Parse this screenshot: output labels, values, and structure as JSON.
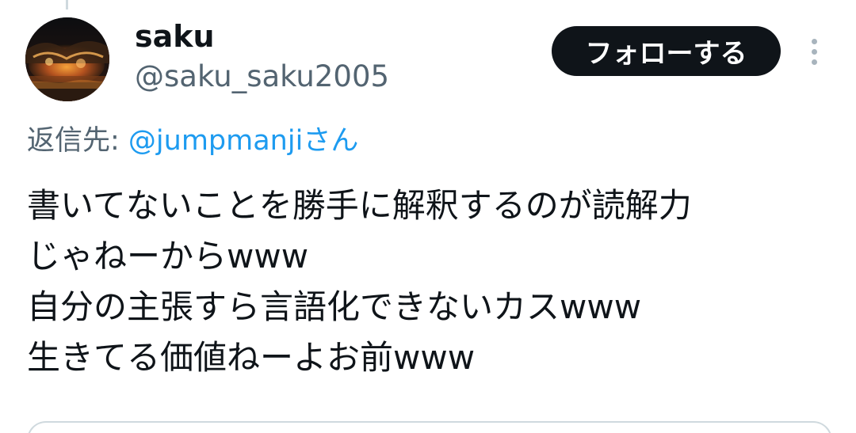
{
  "user": {
    "name": "saku",
    "handle": "@saku_saku2005"
  },
  "actions": {
    "follow_label": "フォローする"
  },
  "reply": {
    "prefix": "返信先: ",
    "target": "@jumpmanjiさん"
  },
  "tweet": {
    "lines": [
      "書いてないことを勝手に解釈するのが読解力",
      "じゃねーからwww",
      "自分の主張すら言語化できないカスwww",
      "生きてる価値ねーよお前www"
    ]
  },
  "icons": {
    "more": "more-vertical-icon"
  },
  "colors": {
    "text": "#0f1419",
    "secondary": "#536471",
    "link": "#1d9bf0",
    "button": "#0f1419",
    "border": "#cfd9de"
  }
}
